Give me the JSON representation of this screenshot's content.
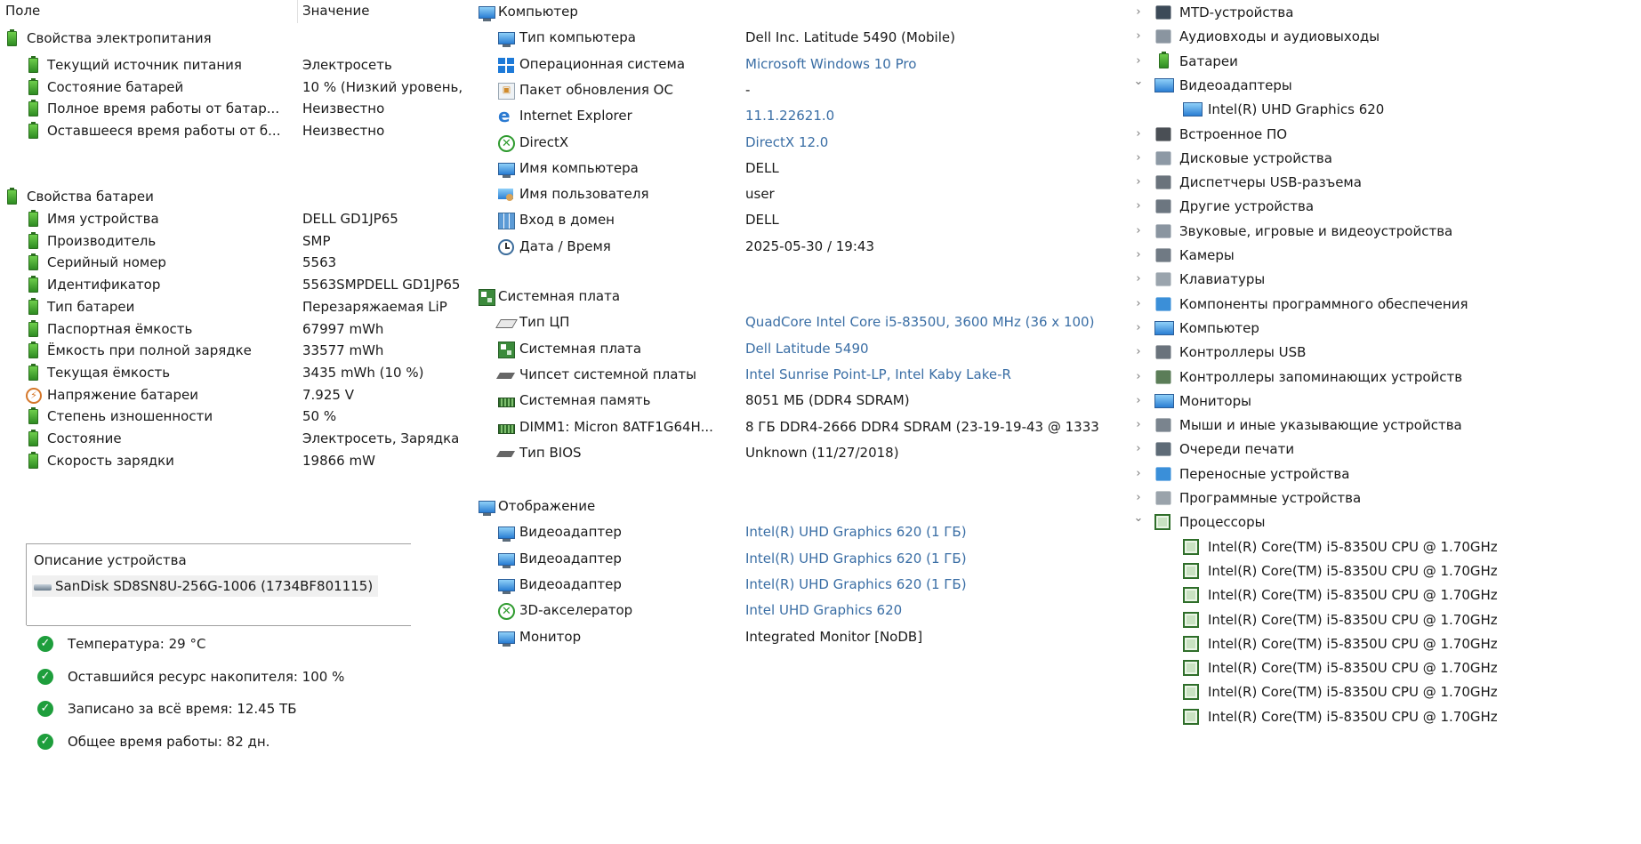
{
  "left": {
    "header": {
      "field": "Поле",
      "value": "Значение"
    },
    "power_group": "Свойства электропитания",
    "power_rows": [
      {
        "label": "Текущий источник питания",
        "value": "Электросеть"
      },
      {
        "label": "Состояние батарей",
        "value": "10 % (Низкий уровень,"
      },
      {
        "label": "Полное время работы от батар...",
        "value": "Неизвестно"
      },
      {
        "label": "Оставшееся время работы от б...",
        "value": "Неизвестно"
      }
    ],
    "battery_group": "Свойства батареи",
    "battery_rows": [
      {
        "label": "Имя устройства",
        "value": "DELL GD1JP65",
        "icon": "battery-icon"
      },
      {
        "label": "Производитель",
        "value": "SMP",
        "icon": "battery-icon"
      },
      {
        "label": "Серийный номер",
        "value": "5563",
        "icon": "battery-icon"
      },
      {
        "label": "Идентификатор",
        "value": "5563SMPDELL GD1JP65",
        "icon": "battery-icon"
      },
      {
        "label": "Тип батареи",
        "value": "Перезаряжаемая LiP",
        "icon": "battery-icon"
      },
      {
        "label": "Паспортная ёмкость",
        "value": "67997 mWh",
        "icon": "battery-icon"
      },
      {
        "label": "Ёмкость при полной зарядке",
        "value": "33577 mWh",
        "icon": "battery-icon"
      },
      {
        "label": "Текущая ёмкость",
        "value": "3435 mWh  (10 %)",
        "icon": "battery-icon"
      },
      {
        "label": "Напряжение батареи",
        "value": "7.925 V",
        "icon": "voltage-icon"
      },
      {
        "label": "Степень изношенности",
        "value": "50 %",
        "icon": "battery-icon"
      },
      {
        "label": "Состояние",
        "value": "Электросеть, Зарядка",
        "icon": "battery-icon"
      },
      {
        "label": "Скорость зарядки",
        "value": "19866 mW",
        "icon": "battery-icon"
      }
    ],
    "disk": {
      "description_label": "Описание устройства",
      "device": "SanDisk SD8SN8U-256G-1006 (1734BF801115)",
      "stats": [
        "Температура: 29 °C",
        "Оставшийся ресурс накопителя: 100 %",
        "Записано за всё время: 12.45 ТБ",
        "Общее время работы: 82 дн."
      ]
    }
  },
  "middle": {
    "groups": [
      {
        "title": "Компьютер",
        "icon": "computer-icon",
        "rows": [
          {
            "label": "Тип компьютера",
            "value": "Dell Inc. Latitude 5490  (Mobile)",
            "link": false,
            "icon": "computer-icon"
          },
          {
            "label": "Операционная система",
            "value": "Microsoft Windows 10 Pro",
            "link": true,
            "icon": "windows-icon"
          },
          {
            "label": "Пакет обновления ОС",
            "value": "-",
            "link": false,
            "icon": "update-icon"
          },
          {
            "label": "Internet Explorer",
            "value": "11.1.22621.0",
            "link": true,
            "icon": "ie-icon"
          },
          {
            "label": "DirectX",
            "value": "DirectX 12.0",
            "link": true,
            "icon": "directx-icon"
          },
          {
            "label": "Имя компьютера",
            "value": "DELL",
            "link": false,
            "icon": "computer-icon"
          },
          {
            "label": "Имя пользователя",
            "value": "user",
            "link": false,
            "icon": "user-icon"
          },
          {
            "label": "Вход в домен",
            "value": "DELL",
            "link": false,
            "icon": "domain-icon"
          },
          {
            "label": "Дата / Время",
            "value": "2025-05-30 / 19:43",
            "link": false,
            "icon": "clock-icon"
          }
        ]
      },
      {
        "title": "Системная плата",
        "icon": "motherboard-icon",
        "rows": [
          {
            "label": "Тип ЦП",
            "value": "QuadCore Intel Core i5-8350U, 3600 MHz (36 x 100)",
            "link": true,
            "icon": "cpu-icon"
          },
          {
            "label": "Системная плата",
            "value": "Dell Latitude 5490",
            "link": true,
            "icon": "motherboard-icon"
          },
          {
            "label": "Чипсет системной платы",
            "value": "Intel Sunrise Point-LP, Intel Kaby Lake-R",
            "link": true,
            "icon": "chipset-icon"
          },
          {
            "label": "Системная память",
            "value": "8051 МБ  (DDR4 SDRAM)",
            "link": false,
            "icon": "memory-icon"
          },
          {
            "label": "DIMM1: Micron 8ATF1G64H...",
            "value": "8 ГБ DDR4-2666 DDR4 SDRAM  (23-19-19-43 @ 1333",
            "link": false,
            "icon": "memory-icon"
          },
          {
            "label": "Тип BIOS",
            "value": "Unknown (11/27/2018)",
            "link": false,
            "icon": "chipset-icon"
          }
        ]
      },
      {
        "title": "Отображение",
        "icon": "display-icon",
        "rows": [
          {
            "label": "Видеоадаптер",
            "value": "Intel(R) UHD Graphics 620  (1 ГБ)",
            "link": true,
            "icon": "display-icon"
          },
          {
            "label": "Видеоадаптер",
            "value": "Intel(R) UHD Graphics 620  (1 ГБ)",
            "link": true,
            "icon": "display-icon"
          },
          {
            "label": "Видеоадаптер",
            "value": "Intel(R) UHD Graphics 620  (1 ГБ)",
            "link": true,
            "icon": "display-icon"
          },
          {
            "label": "3D-акселератор",
            "value": "Intel UHD Graphics 620",
            "link": true,
            "icon": "xbox-icon"
          },
          {
            "label": "Монитор",
            "value": "Integrated Monitor [NoDB]",
            "link": false,
            "icon": "monitor-icon"
          }
        ]
      }
    ]
  },
  "device_manager": {
    "items": [
      {
        "label": "MTD-устройства",
        "state": "collapsed",
        "icon": "mtd-icon"
      },
      {
        "label": "Аудиовходы и аудиовыходы",
        "state": "collapsed",
        "icon": "speaker-icon"
      },
      {
        "label": "Батареи",
        "state": "collapsed",
        "icon": "battery-icon"
      },
      {
        "label": "Видеоадаптеры",
        "state": "expanded",
        "icon": "monitor-icon"
      },
      {
        "label": "Intel(R) UHD Graphics 620",
        "state": "child",
        "icon": "monitor-icon"
      },
      {
        "label": "Встроенное ПО",
        "state": "collapsed",
        "icon": "firmware-icon"
      },
      {
        "label": "Дисковые устройства",
        "state": "collapsed",
        "icon": "disk-icon"
      },
      {
        "label": "Диспетчеры USB-разъема",
        "state": "collapsed",
        "icon": "usb-icon"
      },
      {
        "label": "Другие устройства",
        "state": "collapsed",
        "icon": "unknown-device-icon"
      },
      {
        "label": "Звуковые, игровые и видеоустройства",
        "state": "collapsed",
        "icon": "speaker-icon"
      },
      {
        "label": "Камеры",
        "state": "collapsed",
        "icon": "camera-icon"
      },
      {
        "label": "Клавиатуры",
        "state": "collapsed",
        "icon": "keyboard-icon"
      },
      {
        "label": "Компоненты программного обеспечения",
        "state": "collapsed",
        "icon": "software-component-icon"
      },
      {
        "label": "Компьютер",
        "state": "collapsed",
        "icon": "monitor-icon"
      },
      {
        "label": "Контроллеры USB",
        "state": "collapsed",
        "icon": "usb-icon"
      },
      {
        "label": "Контроллеры запоминающих устройств",
        "state": "collapsed",
        "icon": "storage-controller-icon"
      },
      {
        "label": "Мониторы",
        "state": "collapsed",
        "icon": "monitor-icon"
      },
      {
        "label": "Мыши и иные указывающие устройства",
        "state": "collapsed",
        "icon": "mouse-icon"
      },
      {
        "label": "Очереди печати",
        "state": "collapsed",
        "icon": "printer-icon"
      },
      {
        "label": "Переносные устройства",
        "state": "collapsed",
        "icon": "portable-device-icon"
      },
      {
        "label": "Программные устройства",
        "state": "collapsed",
        "icon": "software-device-icon"
      },
      {
        "label": "Процессоры",
        "state": "expanded",
        "icon": "cpu-chip-icon"
      },
      {
        "label": "Intel(R) Core(TM) i5-8350U CPU @ 1.70GHz",
        "state": "child",
        "icon": "cpu-chip-icon"
      },
      {
        "label": "Intel(R) Core(TM) i5-8350U CPU @ 1.70GHz",
        "state": "child",
        "icon": "cpu-chip-icon"
      },
      {
        "label": "Intel(R) Core(TM) i5-8350U CPU @ 1.70GHz",
        "state": "child",
        "icon": "cpu-chip-icon"
      },
      {
        "label": "Intel(R) Core(TM) i5-8350U CPU @ 1.70GHz",
        "state": "child",
        "icon": "cpu-chip-icon"
      },
      {
        "label": "Intel(R) Core(TM) i5-8350U CPU @ 1.70GHz",
        "state": "child",
        "icon": "cpu-chip-icon"
      },
      {
        "label": "Intel(R) Core(TM) i5-8350U CPU @ 1.70GHz",
        "state": "child",
        "icon": "cpu-chip-icon"
      },
      {
        "label": "Intel(R) Core(TM) i5-8350U CPU @ 1.70GHz",
        "state": "child",
        "icon": "cpu-chip-icon"
      },
      {
        "label": "Intel(R) Core(TM) i5-8350U CPU @ 1.70GHz",
        "state": "child",
        "icon": "cpu-chip-icon"
      }
    ]
  },
  "colors": {
    "link": "#3a6ea5",
    "ok": "#1e9e3c",
    "battery": "#2e8b22"
  }
}
